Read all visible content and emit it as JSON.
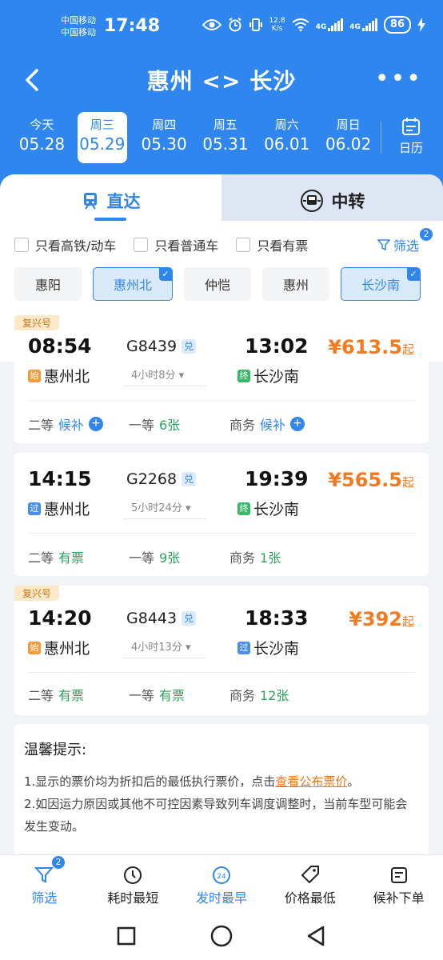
{
  "status": {
    "carrier1": "中国移动",
    "carrier2": "中国移动",
    "time": "17:48",
    "netspeed_top": "12.8",
    "netspeed_unit": "K/s",
    "net1": "4G",
    "net2": "4G",
    "battery": "86"
  },
  "nav": {
    "title": "惠州 <> 长沙"
  },
  "dates": [
    {
      "week": "今天",
      "date": "05.28"
    },
    {
      "week": "周三",
      "date": "05.29"
    },
    {
      "week": "周四",
      "date": "05.30"
    },
    {
      "week": "周五",
      "date": "05.31"
    },
    {
      "week": "周六",
      "date": "06.01"
    },
    {
      "week": "周日",
      "date": "06.02"
    }
  ],
  "calendar_label": "日历",
  "tabs": {
    "direct": "直达",
    "transfer": "中转"
  },
  "filters": {
    "gaotie": "只看高铁/动车",
    "putong": "只看普通车",
    "youpiao": "只看有票",
    "screen": "筛选",
    "screen_count": "2"
  },
  "stations": [
    "惠阳",
    "惠州北",
    "仲恺",
    "惠州",
    "长沙南"
  ],
  "trains": [
    {
      "tag": "复兴号",
      "dep_time": "08:54",
      "arr_time": "13:02",
      "train_no": "G8439",
      "dui": "兑",
      "duration": "4小时8分",
      "from_mark": "始",
      "from": "惠州北",
      "to_mark": "终",
      "to": "长沙南",
      "price": "¥613.5",
      "price_suffix": "起",
      "seats": [
        {
          "cls": "二等",
          "val": "候补"
        },
        {
          "cls": "一等",
          "val": "6张"
        },
        {
          "cls": "商务",
          "val": "候补"
        }
      ]
    },
    {
      "tag": "",
      "dep_time": "14:15",
      "arr_time": "19:39",
      "train_no": "G2268",
      "dui": "兑",
      "duration": "5小时24分",
      "from_mark": "过",
      "from": "惠州北",
      "to_mark": "终",
      "to": "长沙南",
      "price": "¥565.5",
      "price_suffix": "起",
      "seats": [
        {
          "cls": "二等",
          "val": "有票"
        },
        {
          "cls": "一等",
          "val": "9张"
        },
        {
          "cls": "商务",
          "val": "1张"
        }
      ]
    },
    {
      "tag": "复兴号",
      "dep_time": "14:20",
      "arr_time": "18:33",
      "train_no": "G8443",
      "dui": "兑",
      "duration": "4小时13分",
      "from_mark": "始",
      "from": "惠州北",
      "to_mark": "过",
      "to": "长沙南",
      "price": "¥392",
      "price_suffix": "起",
      "seats": [
        {
          "cls": "二等",
          "val": "有票"
        },
        {
          "cls": "一等",
          "val": "有票"
        },
        {
          "cls": "商务",
          "val": "12张"
        }
      ]
    }
  ],
  "tips": {
    "title": "温馨提示:",
    "line1a": "1.显示的票价均为折扣后的最低执行票价，点击",
    "line1link": "查看公布票价",
    "line1b": "。",
    "line2": "2.如因运力原因或其他不可控因素导致列车调度调整时，当前车型可能会发生变动。"
  },
  "bottom": {
    "screen": "筛选",
    "screen_count": "2",
    "shortest": "耗时最短",
    "earliest": "发时最早",
    "cheapest": "价格最低",
    "waitlist": "候补下单"
  },
  "colors": {
    "primary": "#2f86ee",
    "price": "#f47a1f",
    "green": "#29a35a"
  }
}
